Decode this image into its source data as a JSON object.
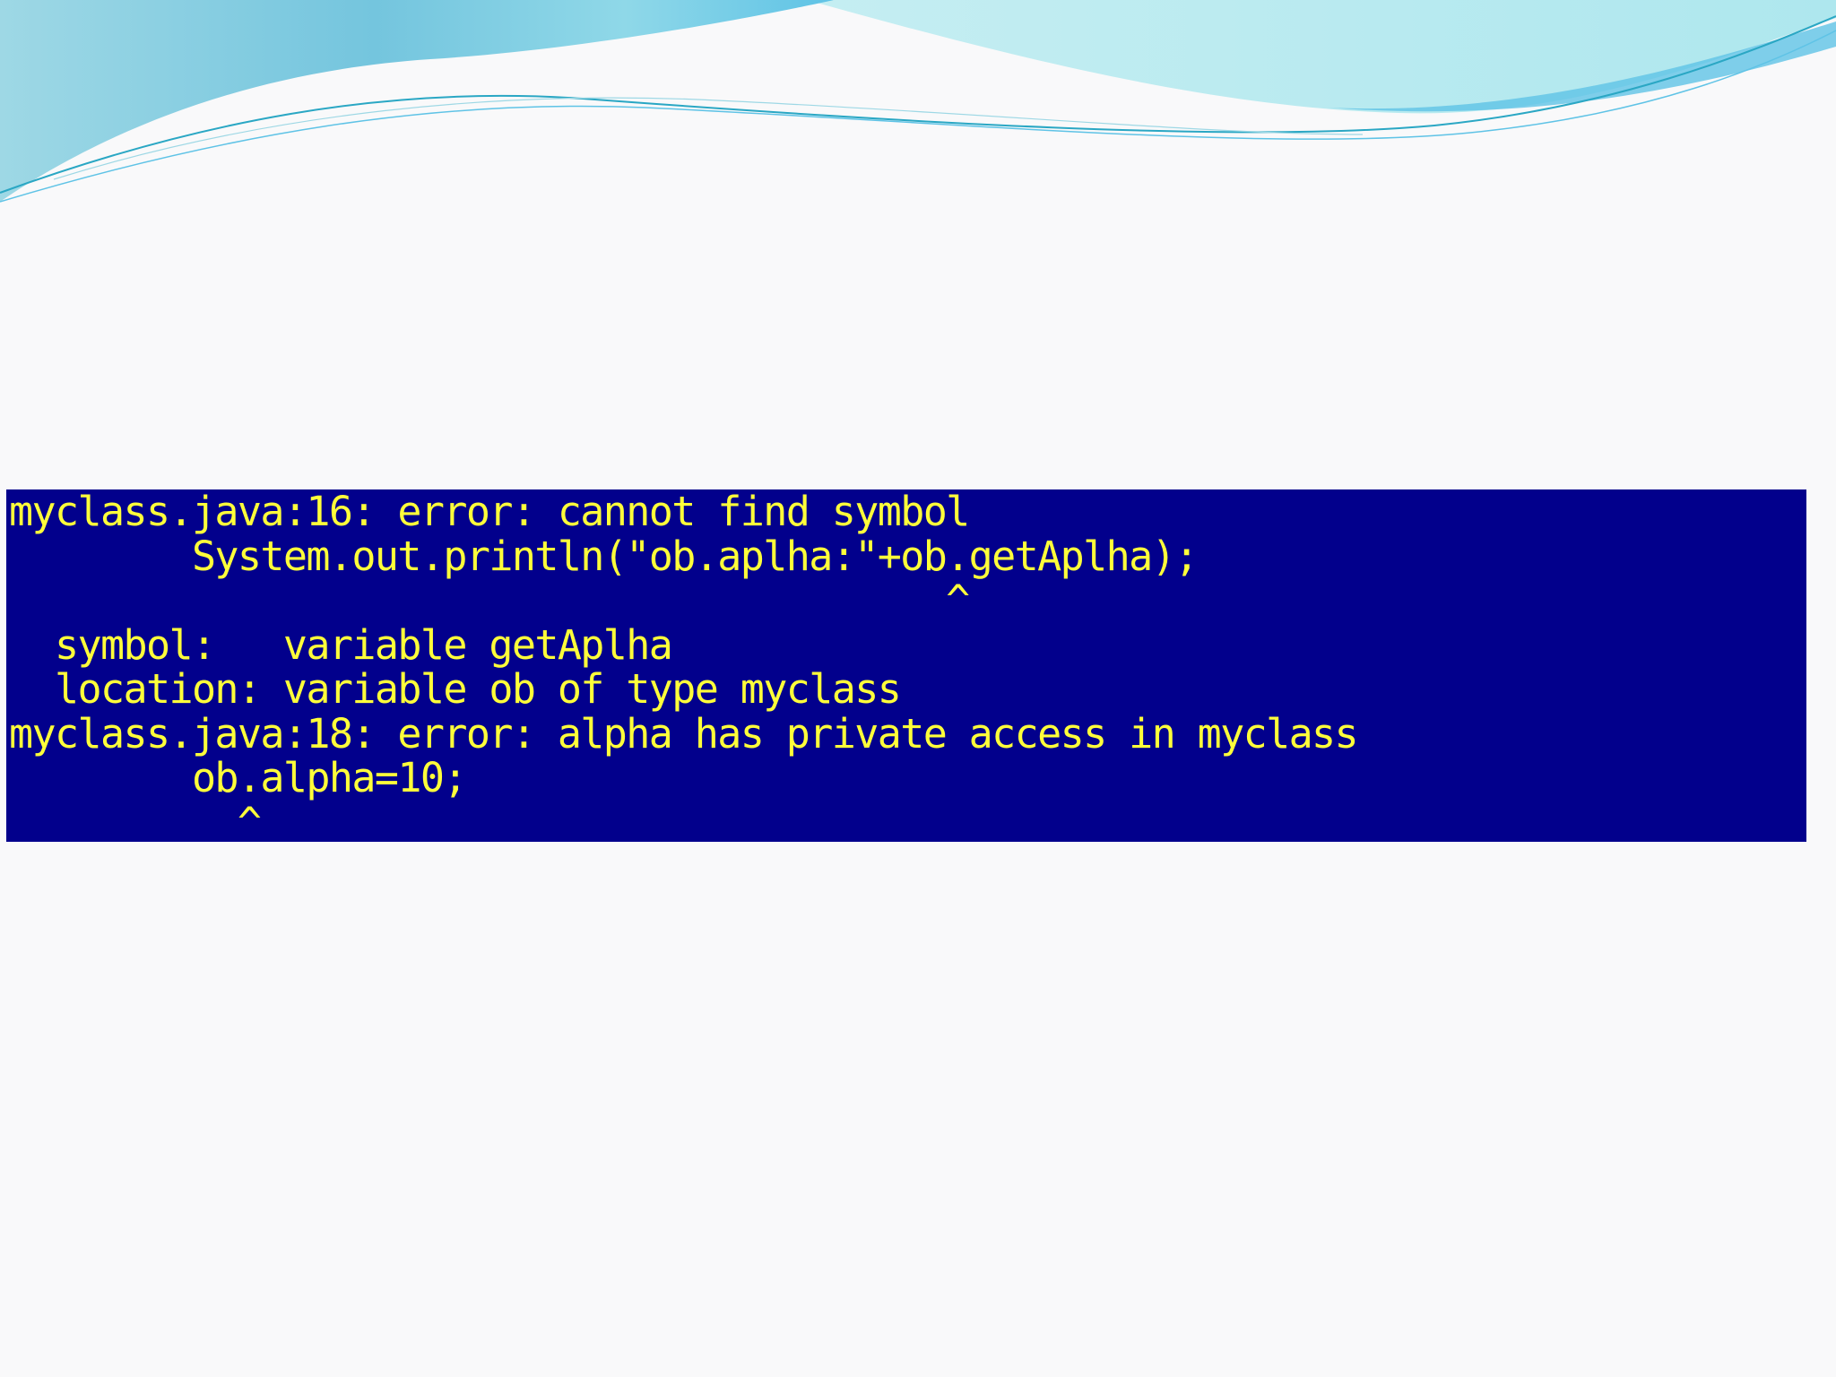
{
  "colors": {
    "slide_background": "#f9f9fa",
    "console_background": "#02008c",
    "console_text": "#ffff3a",
    "wave_light": "#bfe8ee",
    "wave_mid": "#86d7e3",
    "wave_dark": "#2aa7c4"
  },
  "console": {
    "lines": [
      "myclass.java:16: error: cannot find symbol",
      "        System.out.println(\"ob.aplha:\"+ob.getAplha);",
      "                                         ^",
      "  symbol:   variable getAplha",
      "  location: variable ob of type myclass",
      "myclass.java:18: error: alpha has private access in myclass",
      "        ob.alpha=10;",
      "          ^"
    ]
  }
}
